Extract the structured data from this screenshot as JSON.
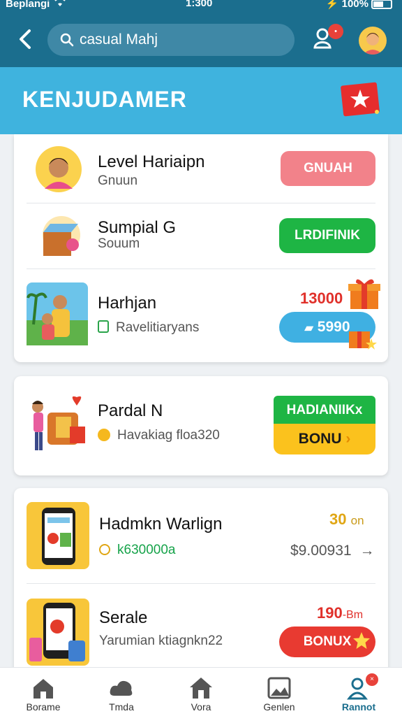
{
  "status_bar": {
    "carrier": "Beplangi",
    "time": "1:300",
    "battery": "100%"
  },
  "header": {
    "search_value": "casual Mahj",
    "notification_badge": "•"
  },
  "banner": {
    "title": "KENJUDAMER"
  },
  "items": [
    {
      "title": "Level Hariaipn",
      "subtitle": "Gnuun",
      "action": "GNUAH"
    },
    {
      "title": "Sumpial G",
      "subtitle": "Souum",
      "action": "LRDIFINIK"
    },
    {
      "title": "Harhjan",
      "subtitle": "Ravelitiaryans",
      "price": "13000",
      "action": "5990"
    },
    {
      "title": "Pardal N",
      "subtitle": "Havakiag floa320",
      "label": "HADIANIIKx",
      "action": "BONU"
    },
    {
      "title": "Hadmkn Warlign",
      "subtitle": "k630000a",
      "price": "30",
      "price_unit": "on",
      "secondary": "$9.00931"
    },
    {
      "title": "Serale",
      "subtitle": "Yarumian ktiagnkn22",
      "price": "190",
      "price_unit": "-Bm",
      "action": "BONUX"
    }
  ],
  "bottom_nav": [
    {
      "label": "Borame",
      "icon": "home-icon"
    },
    {
      "label": "Tmda",
      "icon": "cloud-icon"
    },
    {
      "label": "Vora",
      "icon": "house-icon"
    },
    {
      "label": "Genlen",
      "icon": "gallery-icon"
    },
    {
      "label": "Rannot",
      "icon": "profile-icon",
      "active": true
    }
  ],
  "colors": {
    "header": "#1b6e8e",
    "banner": "#3fb3de",
    "green": "#1eb544",
    "red": "#e83a31",
    "yellow": "#fbc21d",
    "pink": "#f2828a"
  }
}
